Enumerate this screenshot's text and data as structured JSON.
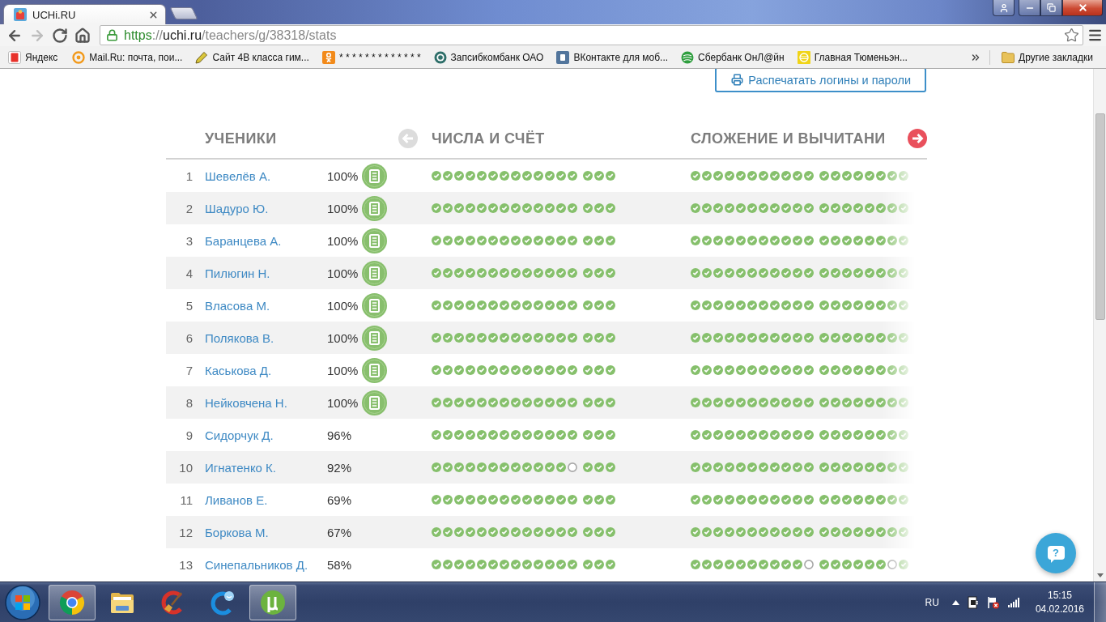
{
  "browser": {
    "tab": {
      "title": "UCHi.RU"
    },
    "nav_buttons": [
      {
        "kind": "back",
        "disabled": false
      },
      {
        "kind": "forward",
        "disabled": true
      },
      {
        "kind": "reload",
        "disabled": false
      },
      {
        "kind": "home",
        "disabled": false
      }
    ],
    "address": [
      {
        "kind": "scheme",
        "text": "https"
      },
      {
        "kind": "plain",
        "text": "://"
      },
      {
        "kind": "host",
        "text": "uchi.ru"
      },
      {
        "kind": "plain",
        "text": "/teachers/g/38318/stats"
      }
    ],
    "bookmarks": [
      {
        "label": "Яндекс",
        "kind": "letter",
        "color": "#e8312a"
      },
      {
        "label": "Mail.Ru: почта, пои...",
        "kind": "ring",
        "color": "#f29a1c"
      },
      {
        "label": "Сайт 4В класса гим...",
        "kind": "pencil",
        "color": "#d9c63a"
      },
      {
        "label": "* * * * * * * * * * * * *",
        "kind": "person",
        "color": "#f28a1a"
      },
      {
        "label": "Запсибкомбанк ОАО",
        "kind": "target",
        "color": "#2f6f6a"
      },
      {
        "label": "ВКонтакте для моб...",
        "kind": "tile",
        "color": "#52759c"
      },
      {
        "label": "Сбербанк ОнЛ@йн",
        "kind": "disc",
        "color": "#2e9e3e"
      },
      {
        "label": "Главная Тюменьэн...",
        "kind": "emblem",
        "color": "#f0d418"
      }
    ],
    "other_bookmarks": "Другие закладки"
  },
  "page": {
    "print_button": "Распечатать логины и пароли",
    "students_title": "УЧЕНИКИ",
    "pager": [
      {
        "kind": "prev",
        "disabled": true
      },
      {
        "kind": "next",
        "disabled": false
      }
    ],
    "topics": [
      {
        "title": "ЧИСЛА И СЧЁТ"
      },
      {
        "title": "СЛОЖЕНИЕ И ВЫЧИТАНИ"
      }
    ],
    "rows": [
      {
        "number": "1",
        "name": "Шевелёв А.",
        "percent": "100%",
        "report": true,
        "topics": [
          {
            "groups": [
              {
                "done": [
                  true,
                  true,
                  true,
                  true,
                  true,
                  true,
                  true,
                  true,
                  true,
                  true,
                  true,
                  true,
                  true
                ]
              },
              {
                "done": [
                  true,
                  true,
                  true
                ]
              }
            ]
          },
          {
            "groups": [
              {
                "done": [
                  true,
                  true,
                  true,
                  true,
                  true,
                  true,
                  true,
                  true,
                  true,
                  true,
                  true
                ]
              },
              {
                "done": [
                  true,
                  true,
                  true,
                  true,
                  true,
                  true,
                  true,
                  true
                ]
              }
            ]
          }
        ]
      },
      {
        "number": "2",
        "name": "Шадуро Ю.",
        "percent": "100%",
        "report": true,
        "topics": [
          {
            "groups": [
              {
                "done": [
                  true,
                  true,
                  true,
                  true,
                  true,
                  true,
                  true,
                  true,
                  true,
                  true,
                  true,
                  true,
                  true
                ]
              },
              {
                "done": [
                  true,
                  true,
                  true
                ]
              }
            ]
          },
          {
            "groups": [
              {
                "done": [
                  true,
                  true,
                  true,
                  true,
                  true,
                  true,
                  true,
                  true,
                  true,
                  true,
                  true
                ]
              },
              {
                "done": [
                  true,
                  true,
                  true,
                  true,
                  true,
                  true,
                  true,
                  true
                ]
              }
            ]
          }
        ]
      },
      {
        "number": "3",
        "name": "Баранцева А.",
        "percent": "100%",
        "report": true,
        "topics": [
          {
            "groups": [
              {
                "done": [
                  true,
                  true,
                  true,
                  true,
                  true,
                  true,
                  true,
                  true,
                  true,
                  true,
                  true,
                  true,
                  true
                ]
              },
              {
                "done": [
                  true,
                  true,
                  true
                ]
              }
            ]
          },
          {
            "groups": [
              {
                "done": [
                  true,
                  true,
                  true,
                  true,
                  true,
                  true,
                  true,
                  true,
                  true,
                  true,
                  true
                ]
              },
              {
                "done": [
                  true,
                  true,
                  true,
                  true,
                  true,
                  true,
                  true,
                  true
                ]
              }
            ]
          }
        ]
      },
      {
        "number": "4",
        "name": "Пилюгин Н.",
        "percent": "100%",
        "report": true,
        "topics": [
          {
            "groups": [
              {
                "done": [
                  true,
                  true,
                  true,
                  true,
                  true,
                  true,
                  true,
                  true,
                  true,
                  true,
                  true,
                  true,
                  true
                ]
              },
              {
                "done": [
                  true,
                  true,
                  true
                ]
              }
            ]
          },
          {
            "groups": [
              {
                "done": [
                  true,
                  true,
                  true,
                  true,
                  true,
                  true,
                  true,
                  true,
                  true,
                  true,
                  true
                ]
              },
              {
                "done": [
                  true,
                  true,
                  true,
                  true,
                  true,
                  true,
                  true,
                  true
                ]
              }
            ]
          }
        ]
      },
      {
        "number": "5",
        "name": "Власова М.",
        "percent": "100%",
        "report": true,
        "topics": [
          {
            "groups": [
              {
                "done": [
                  true,
                  true,
                  true,
                  true,
                  true,
                  true,
                  true,
                  true,
                  true,
                  true,
                  true,
                  true,
                  true
                ]
              },
              {
                "done": [
                  true,
                  true,
                  true
                ]
              }
            ]
          },
          {
            "groups": [
              {
                "done": [
                  true,
                  true,
                  true,
                  true,
                  true,
                  true,
                  true,
                  true,
                  true,
                  true,
                  true
                ]
              },
              {
                "done": [
                  true,
                  true,
                  true,
                  true,
                  true,
                  true,
                  true,
                  true
                ]
              }
            ]
          }
        ]
      },
      {
        "number": "6",
        "name": "Полякова В.",
        "percent": "100%",
        "report": true,
        "topics": [
          {
            "groups": [
              {
                "done": [
                  true,
                  true,
                  true,
                  true,
                  true,
                  true,
                  true,
                  true,
                  true,
                  true,
                  true,
                  true,
                  true
                ]
              },
              {
                "done": [
                  true,
                  true,
                  true
                ]
              }
            ]
          },
          {
            "groups": [
              {
                "done": [
                  true,
                  true,
                  true,
                  true,
                  true,
                  true,
                  true,
                  true,
                  true,
                  true,
                  true
                ]
              },
              {
                "done": [
                  true,
                  true,
                  true,
                  true,
                  true,
                  true,
                  true,
                  true
                ]
              }
            ]
          }
        ]
      },
      {
        "number": "7",
        "name": "Каськова Д.",
        "percent": "100%",
        "report": true,
        "topics": [
          {
            "groups": [
              {
                "done": [
                  true,
                  true,
                  true,
                  true,
                  true,
                  true,
                  true,
                  true,
                  true,
                  true,
                  true,
                  true,
                  true
                ]
              },
              {
                "done": [
                  true,
                  true,
                  true
                ]
              }
            ]
          },
          {
            "groups": [
              {
                "done": [
                  true,
                  true,
                  true,
                  true,
                  true,
                  true,
                  true,
                  true,
                  true,
                  true,
                  true
                ]
              },
              {
                "done": [
                  true,
                  true,
                  true,
                  true,
                  true,
                  true,
                  true,
                  true
                ]
              }
            ]
          }
        ]
      },
      {
        "number": "8",
        "name": "Нейковчена Н.",
        "percent": "100%",
        "report": true,
        "topics": [
          {
            "groups": [
              {
                "done": [
                  true,
                  true,
                  true,
                  true,
                  true,
                  true,
                  true,
                  true,
                  true,
                  true,
                  true,
                  true,
                  true
                ]
              },
              {
                "done": [
                  true,
                  true,
                  true
                ]
              }
            ]
          },
          {
            "groups": [
              {
                "done": [
                  true,
                  true,
                  true,
                  true,
                  true,
                  true,
                  true,
                  true,
                  true,
                  true,
                  true
                ]
              },
              {
                "done": [
                  true,
                  true,
                  true,
                  true,
                  true,
                  true,
                  true,
                  true
                ]
              }
            ]
          }
        ]
      },
      {
        "number": "9",
        "name": "Сидорчук Д.",
        "percent": "96%",
        "report": false,
        "topics": [
          {
            "groups": [
              {
                "done": [
                  true,
                  true,
                  true,
                  true,
                  true,
                  true,
                  true,
                  true,
                  true,
                  true,
                  true,
                  true,
                  true
                ]
              },
              {
                "done": [
                  true,
                  true,
                  true
                ]
              }
            ]
          },
          {
            "groups": [
              {
                "done": [
                  true,
                  true,
                  true,
                  true,
                  true,
                  true,
                  true,
                  true,
                  true,
                  true,
                  true
                ]
              },
              {
                "done": [
                  true,
                  true,
                  true,
                  true,
                  true,
                  true,
                  true,
                  true
                ]
              }
            ]
          }
        ]
      },
      {
        "number": "10",
        "name": "Игнатенко К.",
        "percent": "92%",
        "report": false,
        "topics": [
          {
            "groups": [
              {
                "done": [
                  true,
                  true,
                  true,
                  true,
                  true,
                  true,
                  true,
                  true,
                  true,
                  true,
                  true,
                  true,
                  false
                ]
              },
              {
                "done": [
                  true,
                  true,
                  true
                ]
              }
            ]
          },
          {
            "groups": [
              {
                "done": [
                  true,
                  true,
                  true,
                  true,
                  true,
                  true,
                  true,
                  true,
                  true,
                  true,
                  true
                ]
              },
              {
                "done": [
                  true,
                  true,
                  true,
                  true,
                  true,
                  true,
                  true,
                  true
                ]
              }
            ]
          }
        ]
      },
      {
        "number": "11",
        "name": "Ливанов Е.",
        "percent": "69%",
        "report": false,
        "topics": [
          {
            "groups": [
              {
                "done": [
                  true,
                  true,
                  true,
                  true,
                  true,
                  true,
                  true,
                  true,
                  true,
                  true,
                  true,
                  true,
                  true
                ]
              },
              {
                "done": [
                  true,
                  true,
                  true
                ]
              }
            ]
          },
          {
            "groups": [
              {
                "done": [
                  true,
                  true,
                  true,
                  true,
                  true,
                  true,
                  true,
                  true,
                  true,
                  true,
                  true
                ]
              },
              {
                "done": [
                  true,
                  true,
                  true,
                  true,
                  true,
                  true,
                  true,
                  true
                ]
              }
            ]
          }
        ]
      },
      {
        "number": "12",
        "name": "Боркова М.",
        "percent": "67%",
        "report": false,
        "topics": [
          {
            "groups": [
              {
                "done": [
                  true,
                  true,
                  true,
                  true,
                  true,
                  true,
                  true,
                  true,
                  true,
                  true,
                  true,
                  true,
                  true
                ]
              },
              {
                "done": [
                  true,
                  true,
                  true
                ]
              }
            ]
          },
          {
            "groups": [
              {
                "done": [
                  true,
                  true,
                  true,
                  true,
                  true,
                  true,
                  true,
                  true,
                  true,
                  true,
                  true
                ]
              },
              {
                "done": [
                  true,
                  true,
                  true,
                  true,
                  true,
                  true,
                  true,
                  true
                ]
              }
            ]
          }
        ]
      },
      {
        "number": "13",
        "name": "Синепальников Д.",
        "percent": "58%",
        "report": false,
        "topics": [
          {
            "groups": [
              {
                "done": [
                  true,
                  true,
                  true,
                  true,
                  true,
                  true,
                  true,
                  true,
                  true,
                  true,
                  true,
                  true,
                  true
                ]
              },
              {
                "done": [
                  true,
                  true,
                  true
                ]
              }
            ]
          },
          {
            "groups": [
              {
                "done": [
                  true,
                  true,
                  true,
                  true,
                  true,
                  true,
                  true,
                  true,
                  true,
                  true,
                  false
                ]
              },
              {
                "done": [
                  true,
                  true,
                  true,
                  true,
                  true,
                  true,
                  false,
                  true
                ]
              }
            ]
          }
        ]
      }
    ],
    "help_button": "?"
  },
  "taskbar": {
    "apps": [
      {
        "kind": "wheel",
        "running": true
      },
      {
        "kind": "folder",
        "running": false
      },
      {
        "kind": "broom",
        "running": false
      },
      {
        "kind": "ring",
        "running": false
      },
      {
        "kind": "torrent",
        "running": true
      }
    ],
    "language": "RU",
    "time": "15:15",
    "date": "04.02.2016"
  }
}
